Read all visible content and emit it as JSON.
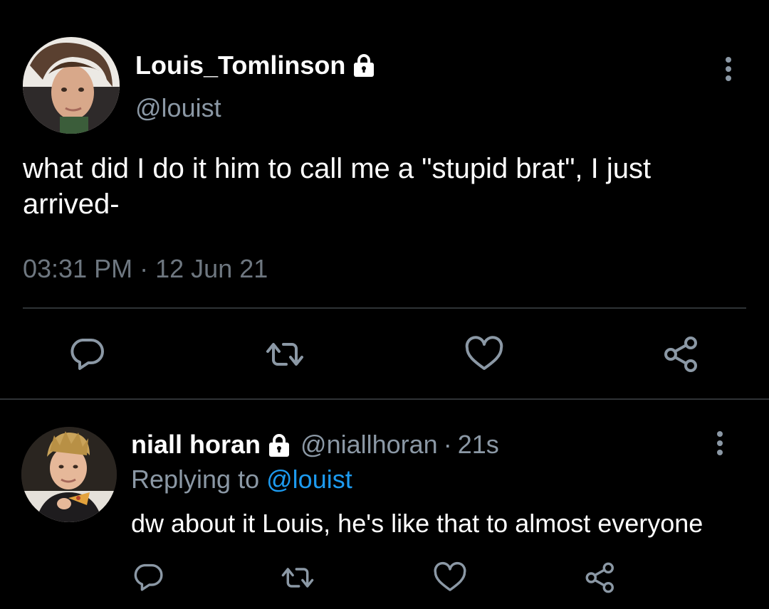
{
  "tweet": {
    "author_name": "Louis_Tomlinson",
    "author_handle": "@louist",
    "text": "what did I do it him to call me a \"stupid brat\", I just arrived-",
    "time": "03:31 PM",
    "separator": "·",
    "date": "12 Jun 21",
    "icons": {
      "avatar": "profile-photo",
      "lock": "lock-icon",
      "more": "more-vertical-icon",
      "reply": "reply-bubble-icon",
      "retweet": "retweet-icon",
      "like": "heart-icon",
      "share": "share-icon"
    }
  },
  "reply": {
    "author_name": "niall horan",
    "author_handle": "@niallhoran",
    "separator": "·",
    "age": "21s",
    "replying_label": "Replying to",
    "replying_handle": "@louist",
    "text": "dw about it Louis, he's like that to almost everyone"
  },
  "colors": {
    "background": "#000000",
    "text": "#ffffff",
    "muted": "#8b98a5",
    "link": "#1d9bf0",
    "divider": "#2f3336",
    "icon": "#8b98a5"
  }
}
